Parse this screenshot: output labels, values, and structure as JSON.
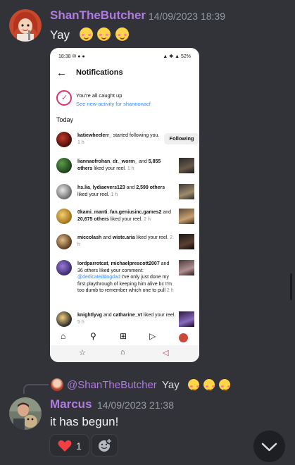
{
  "message1": {
    "username": "ShanTheButcher",
    "timestamp": "14/09/2023 18:39",
    "text": "Yay",
    "emoji": "smiling-face-with-hearts",
    "emoji_count": 3
  },
  "phone": {
    "status_time": "18:38",
    "battery": "52%",
    "title": "Notifications",
    "caught_up_text": "You're all caught up",
    "caught_up_link": "See new activity for shannonacf",
    "section": "Today",
    "notifications": [
      {
        "html": "<b>katiewheelerr_</b> started following you. <span class='n-meta'>1 h</span>",
        "action": "Following"
      },
      {
        "html": "<b>liannaofrohan</b>, <b>dr._worm_</b> and <b>5,855 others</b> liked your reel. <span class='n-meta'>1 h</span>"
      },
      {
        "html": "<b>hs.lia</b>, <b>lydiaevers123</b> and <b>2,599 others</b> liked your reel. <span class='n-meta'>1 h</span>"
      },
      {
        "html": "<b>0kami_manti</b>, <b>fan.geniusinc.games2</b> and <b>20,675 others</b> liked your reel. <span class='n-meta'>2 h</span>"
      },
      {
        "html": "<b>miccolash</b> and <b>wiste.aria</b> liked your reel. <span class='n-meta'>2 h</span>"
      },
      {
        "html": "<b>lordparrotcat</b>, <b>michaelprescott2007</b> and 36 others liked your comment: <span style='color:#3d8af7'>@dedicateddogdad</span> I've only just done my first playthrough of keeping him alive bc I'm too dumb to remember which one to pull <span class='n-meta'>2 h</span>"
      },
      {
        "html": "<b>knightlyvg</b> and <b>catharine_vt</b> liked your reel. <span class='n-meta'>5 h</span>"
      }
    ]
  },
  "reply": {
    "mention": "@ShanTheButcher",
    "text": "Yay"
  },
  "message2": {
    "username": "Marcus",
    "timestamp": "14/09/2023 21:38",
    "text": "it has begun!"
  },
  "reactions": {
    "heart_count": "1"
  },
  "colors": {
    "background": "#313338",
    "username": "#b07ce0",
    "timestamp": "#949ba4"
  }
}
